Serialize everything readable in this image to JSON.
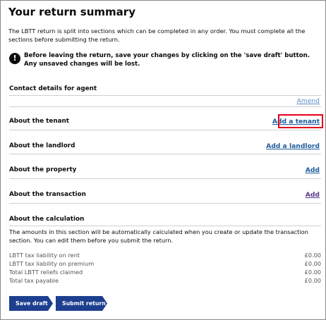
{
  "page": {
    "title": "Your return summary",
    "intro": "The LBTT return is split into sections which can be completed in any order. You must complete all the sections before submitting the return.",
    "warning": "Before leaving the return, save your changes by clicking on the 'save draft' button. Any unsaved changes will be lost.",
    "warning_icon": "!"
  },
  "sections": {
    "agent": {
      "title": "Contact details for agent",
      "action": "Amend"
    },
    "tenant": {
      "title": "About the tenant",
      "action": "Add a tenant"
    },
    "landlord": {
      "title": "About the landlord",
      "action": "Add a landlord"
    },
    "property": {
      "title": "About the property",
      "action": "Add"
    },
    "transaction": {
      "title": "About the transaction",
      "action": "Add"
    }
  },
  "calculation": {
    "title": "About the calculation",
    "note": "The amounts in this section will be automatically calculated when you create or update the transaction section. You can edit them before you submit the return.",
    "rows": [
      {
        "label": "LBTT tax liability on rent",
        "value": "£0.00"
      },
      {
        "label": "LBTT tax liability on premium",
        "value": "£0.00"
      },
      {
        "label": "Total LBTT reliefs claimed",
        "value": "£0.00"
      },
      {
        "label": "Total tax payable",
        "value": "£0.00"
      }
    ]
  },
  "buttons": {
    "save_draft": "Save draft",
    "submit": "Submit return"
  },
  "colors": {
    "link": "#1d5b9b",
    "button": "#1d3f8f",
    "highlight": "#e3001b"
  }
}
